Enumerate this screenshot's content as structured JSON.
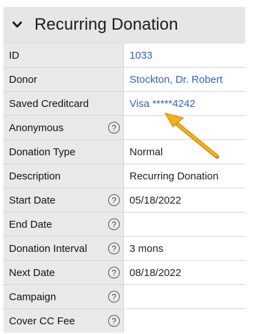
{
  "panel": {
    "title": "Recurring Donation",
    "rows": [
      {
        "label": "ID",
        "value": "1033",
        "help": false,
        "link": true
      },
      {
        "label": "Donor",
        "value": "Stockton, Dr. Robert",
        "help": false,
        "link": true
      },
      {
        "label": "Saved Creditcard",
        "value": "Visa *****4242",
        "help": false,
        "link": true
      },
      {
        "label": "Anonymous",
        "value": "",
        "help": true,
        "link": false
      },
      {
        "label": "Donation Type",
        "value": "Normal",
        "help": false,
        "link": false
      },
      {
        "label": "Description",
        "value": "Recurring Donation",
        "help": false,
        "link": false
      },
      {
        "label": "Start Date",
        "value": "05/18/2022",
        "help": true,
        "link": false
      },
      {
        "label": "End Date",
        "value": "",
        "help": true,
        "link": false
      },
      {
        "label": "Donation Interval",
        "value": "3 mons",
        "help": true,
        "link": false
      },
      {
        "label": "Next Date",
        "value": "08/18/2022",
        "help": true,
        "link": false
      },
      {
        "label": "Campaign",
        "value": "",
        "help": true,
        "link": false
      },
      {
        "label": "Cover CC Fee",
        "value": "",
        "help": true,
        "link": false
      }
    ],
    "help_glyph": "?"
  },
  "colors": {
    "link": "#3a5cc9",
    "annotation_arrow": "#f2b01e"
  }
}
